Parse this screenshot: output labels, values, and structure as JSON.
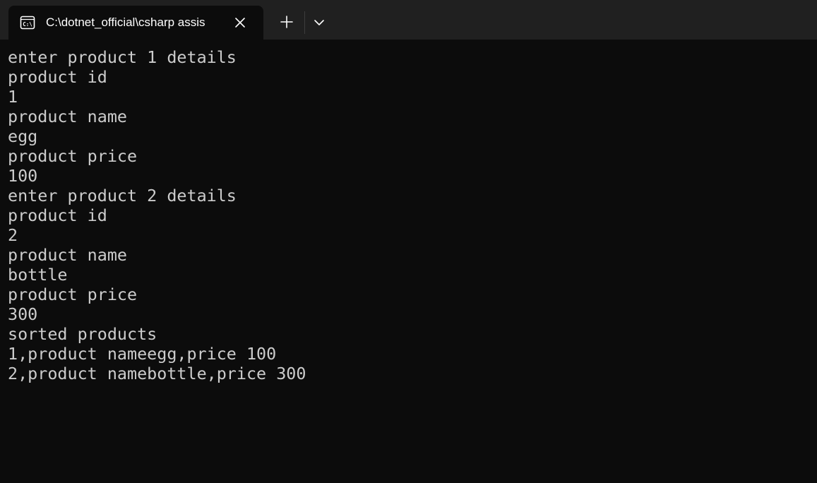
{
  "tab": {
    "icon": "terminal-icon",
    "title": "C:\\dotnet_official\\csharp assis",
    "close_icon": "close-icon"
  },
  "toolbar": {
    "new_tab_icon": "plus-icon",
    "dropdown_icon": "chevron-down-icon"
  },
  "console": {
    "lines": [
      "enter product 1 details",
      "product id",
      "1",
      "product name",
      "egg",
      "product price",
      "100",
      "enter product 2 details",
      "product id",
      "2",
      "product name",
      "bottle",
      "product price",
      "300",
      "sorted products",
      "1,product nameegg,price 100",
      "2,product namebottle,price 300"
    ]
  },
  "colors": {
    "background": "#0c0c0c",
    "titlebar": "#202020",
    "text": "#cccccc",
    "tab_text": "#ffffff"
  }
}
